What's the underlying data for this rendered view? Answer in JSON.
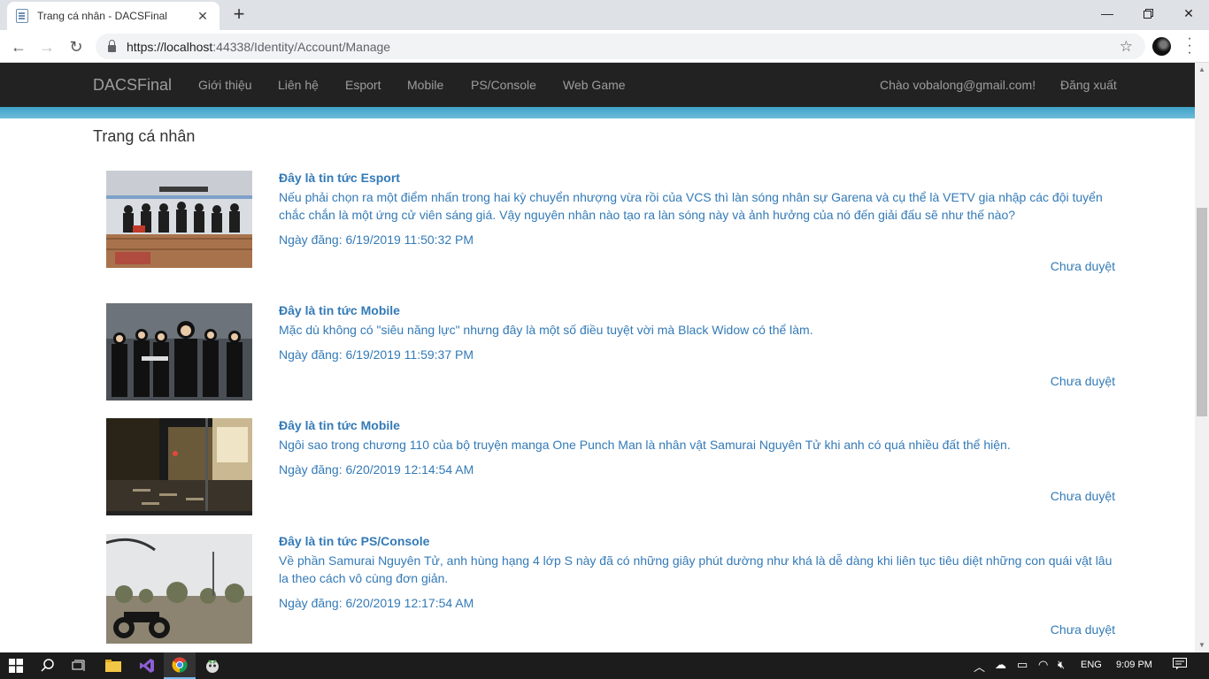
{
  "browser": {
    "tab_title": "Trang cá nhân - DACSFinal",
    "url_host": "https://localhost",
    "url_rest": ":44338/Identity/Account/Manage"
  },
  "navbar": {
    "brand": "DACSFinal",
    "links": [
      "Giới thiệu",
      "Liên hệ",
      "Esport",
      "Mobile",
      "PS/Console",
      "Web Game"
    ],
    "greeting": "Chào vobalong@gmail.com!",
    "logout": "Đăng xuất"
  },
  "page_title": "Trang cá nhân",
  "posts": [
    {
      "title": "Đây là tin tức Esport",
      "description": "Nếu phải chọn ra một điểm nhấn trong hai kỳ chuyển nhượng vừa rồi của VCS thì làn sóng nhân sự Garena và cụ thể là VETV gia nhập các đội tuyển chắc chắn là một ứng cử viên sáng giá. Vậy nguyên nhân nào tạo ra làn sóng này và ảnh hưởng của nó đến giải đấu sẽ như thế nào?",
      "date": "Ngày đăng: 6/19/2019 11:50:32 PM",
      "status": "Chưa duyệt"
    },
    {
      "title": "Đây là tin tức Mobile",
      "description": "Mặc dù không có \"siêu năng lực\" nhưng đây là một số điều tuyệt vời mà Black Widow có thể làm.",
      "date": "Ngày đăng: 6/19/2019 11:59:37 PM",
      "status": "Chưa duyệt"
    },
    {
      "title": "Đây là tin tức Mobile",
      "description": "Ngôi sao trong chương 110 của bộ truyện manga One Punch Man là nhân vật Samurai Nguyên Tử khi anh có quá nhiều đất thể hiện.",
      "date": "Ngày đăng: 6/20/2019 12:14:54 AM",
      "status": "Chưa duyệt"
    },
    {
      "title": "Đây là tin tức PS/Console",
      "description": "Về phần Samurai Nguyên Tử, anh hùng hạng 4 lớp S này đã có những giây phút dường như khá là dễ dàng khi liên tục tiêu diệt những con quái vật lâu la theo cách vô cùng đơn giản.",
      "date": "Ngày đăng: 6/20/2019 12:17:54 AM",
      "status": "Chưa duyệt"
    }
  ],
  "taskbar": {
    "language": "ENG",
    "time": "9:09 PM"
  }
}
